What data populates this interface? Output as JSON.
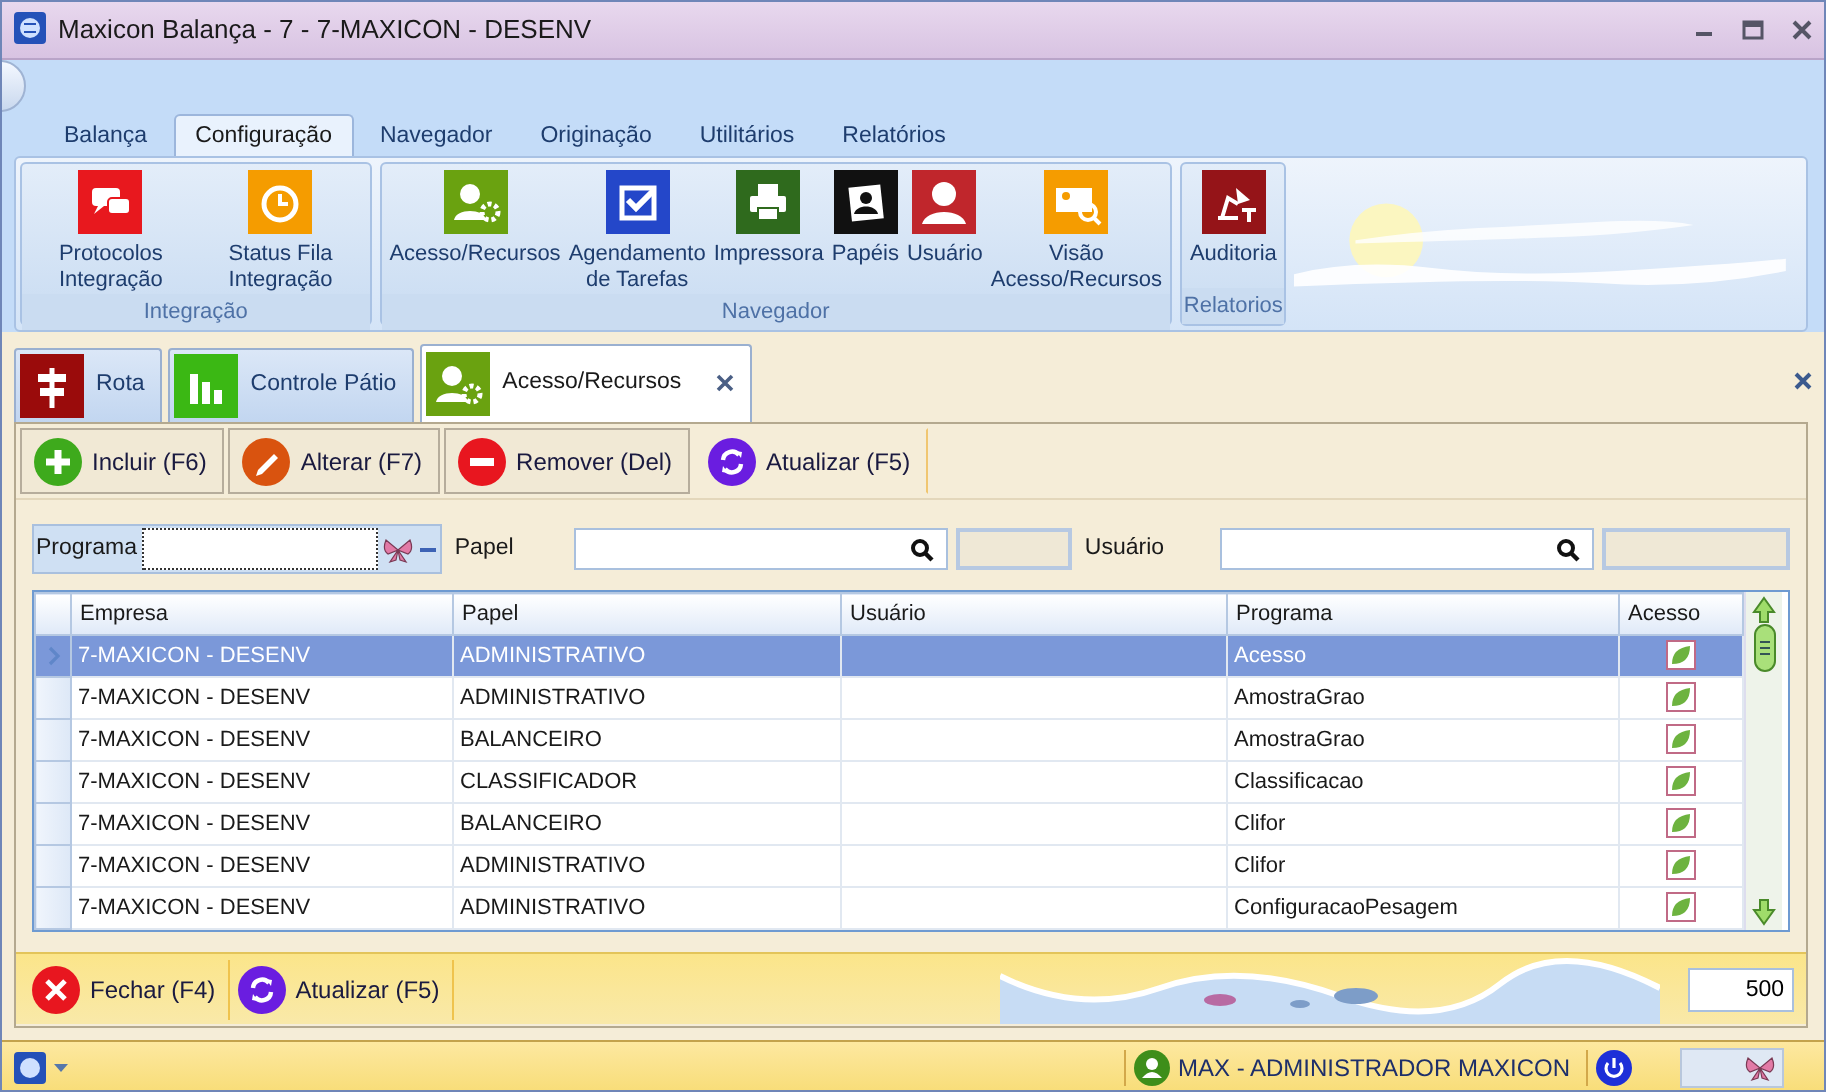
{
  "window": {
    "title": "Maxicon Balança - 7 - 7-MAXICON - DESENV"
  },
  "ribbon": {
    "tabs": [
      {
        "label": "Balança",
        "selected": false
      },
      {
        "label": "Configuração",
        "selected": true
      },
      {
        "label": "Navegador",
        "selected": false
      },
      {
        "label": "Originação",
        "selected": false
      },
      {
        "label": "Utilitários",
        "selected": false
      },
      {
        "label": "Relatórios",
        "selected": false
      }
    ],
    "groups": [
      {
        "label": "Integração",
        "items": [
          {
            "label": "Protocolos Integração",
            "kind": "chat"
          },
          {
            "label": "Status Fila Integração",
            "kind": "clock"
          }
        ]
      },
      {
        "label": "Navegador",
        "items": [
          {
            "label": "Acesso/Recursos",
            "kind": "users"
          },
          {
            "label": "Agendamento de Tarefas",
            "kind": "check"
          },
          {
            "label": "Impressora",
            "kind": "printer"
          },
          {
            "label": "Papéis",
            "kind": "photo"
          },
          {
            "label": "Usuário",
            "kind": "user"
          },
          {
            "label": "Visão Acesso/Recursos",
            "kind": "card"
          }
        ]
      },
      {
        "label": "Relatorios",
        "items": [
          {
            "label": "Auditoria",
            "kind": "lamp"
          }
        ]
      }
    ]
  },
  "doc_tabs": [
    {
      "label": "Rota",
      "kind": "sign",
      "selected": false
    },
    {
      "label": "Controle Pátio",
      "kind": "chart",
      "selected": false
    },
    {
      "label": "Acesso/Recursos",
      "kind": "users",
      "selected": true
    }
  ],
  "toolbar": [
    {
      "label": "Incluir (F6)",
      "kind": "add"
    },
    {
      "label": "Alterar (F7)",
      "kind": "edit"
    },
    {
      "label": "Remover (Del)",
      "kind": "remove"
    },
    {
      "label": "Atualizar (F5)",
      "kind": "refresh"
    }
  ],
  "filters": [
    {
      "label": "Programa",
      "kind": "lookup"
    },
    {
      "label": "Papel",
      "kind": "search"
    },
    {
      "label": "Usuário",
      "kind": "search"
    }
  ],
  "grid": {
    "columns": [
      "Empresa",
      "Papel",
      "Usuário",
      "Programa",
      "Acesso"
    ],
    "rows": [
      {
        "cells": [
          "7-MAXICON - DESENV",
          "ADMINISTRATIVO",
          "",
          "Acesso"
        ],
        "checked": true,
        "selected": true
      },
      {
        "cells": [
          "7-MAXICON - DESENV",
          "ADMINISTRATIVO",
          "",
          "AmostraGrao"
        ],
        "checked": true,
        "selected": false
      },
      {
        "cells": [
          "7-MAXICON - DESENV",
          "BALANCEIRO",
          "",
          "AmostraGrao"
        ],
        "checked": true,
        "selected": false
      },
      {
        "cells": [
          "7-MAXICON - DESENV",
          "CLASSIFICADOR",
          "",
          "Classificacao"
        ],
        "checked": true,
        "selected": false
      },
      {
        "cells": [
          "7-MAXICON - DESENV",
          "BALANCEIRO",
          "",
          "Clifor"
        ],
        "checked": true,
        "selected": false
      },
      {
        "cells": [
          "7-MAXICON - DESENV",
          "ADMINISTRATIVO",
          "",
          "Clifor"
        ],
        "checked": true,
        "selected": false
      },
      {
        "cells": [
          "7-MAXICON - DESENV",
          "ADMINISTRATIVO",
          "",
          "ConfiguracaoPesagem"
        ],
        "checked": true,
        "selected": false
      }
    ]
  },
  "bottom_bar": {
    "buttons": [
      {
        "label": "Fechar (F4)",
        "kind": "close"
      },
      {
        "label": "Atualizar (F5)",
        "kind": "refresh"
      }
    ],
    "page_size": "500"
  },
  "status_bar": {
    "user": "MAX - ADMINISTRADOR MAXICON"
  }
}
